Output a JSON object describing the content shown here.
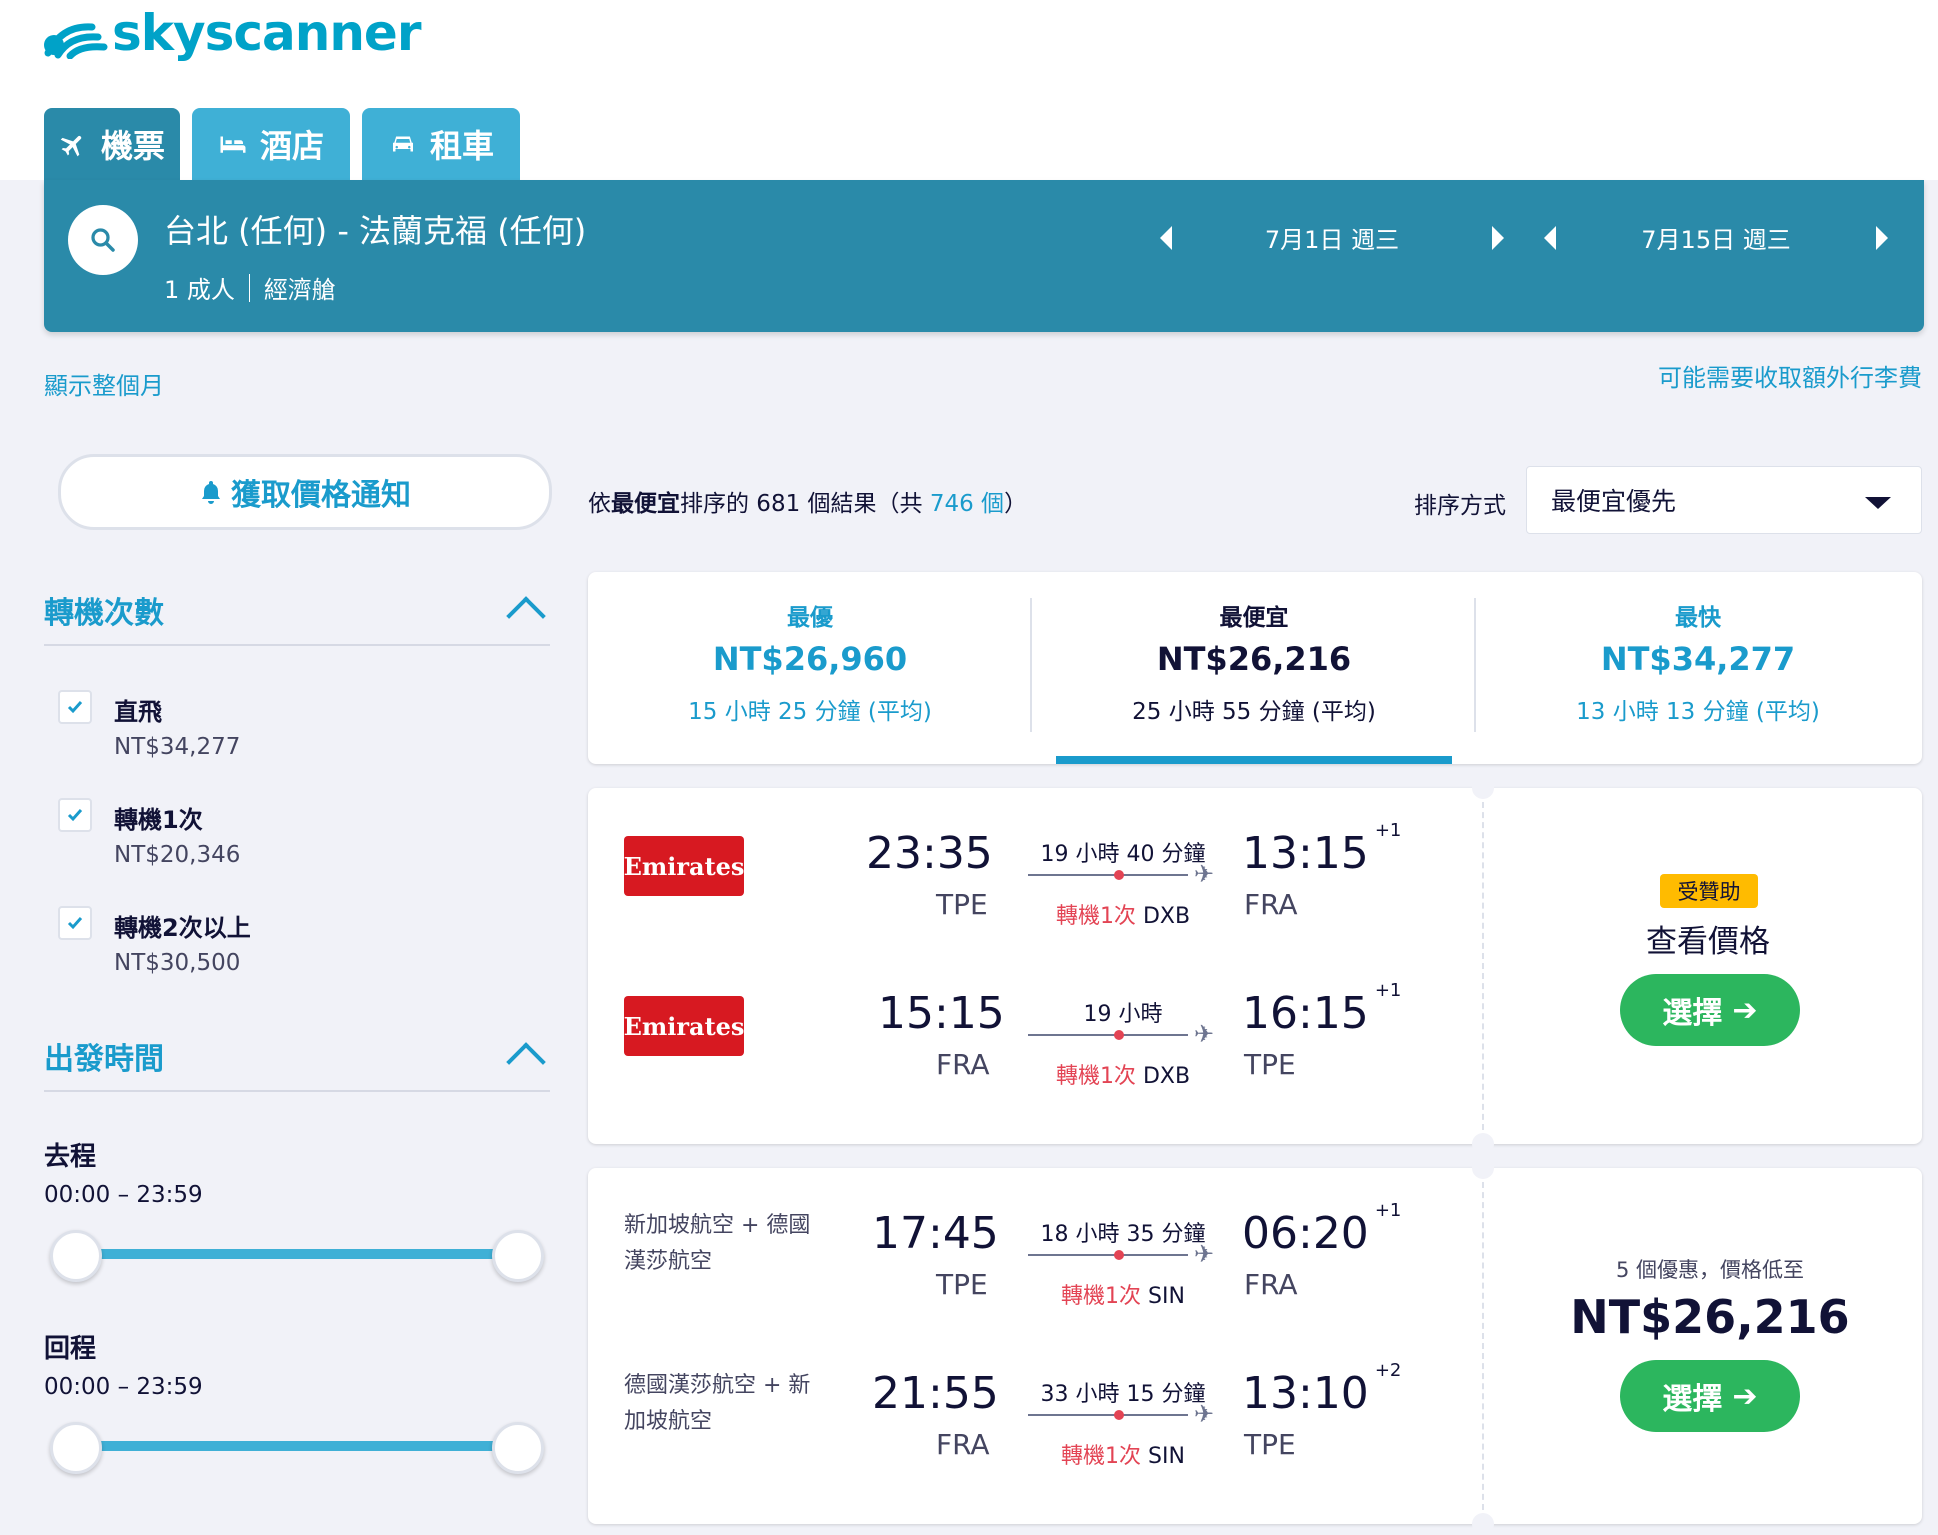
{
  "brand": {
    "name": "skyscanner"
  },
  "tabs": [
    {
      "label": "機票",
      "icon": "plane-icon",
      "active": true
    },
    {
      "label": "酒店",
      "icon": "bed-icon",
      "active": false
    },
    {
      "label": "租車",
      "icon": "car-icon",
      "active": false
    }
  ],
  "search": {
    "route": "台北 (任何) - 法蘭克福 (任何)",
    "adults": "1 成人",
    "cabin": "經濟艙",
    "depart_date": "7月1日 週三",
    "return_date": "7月15日 週三"
  },
  "links": {
    "show_month": "顯示整個月",
    "baggage": "可能需要收取額外行李費"
  },
  "alert": {
    "label": "獲取價格通知"
  },
  "filters": {
    "stops": {
      "title": "轉機次數",
      "options": [
        {
          "label": "直飛",
          "price": "NT$34,277",
          "checked": true
        },
        {
          "label": "轉機1次",
          "price": "NT$20,346",
          "checked": true
        },
        {
          "label": "轉機2次以上",
          "price": "NT$30,500",
          "checked": true
        }
      ]
    },
    "times": {
      "title": "出發時間",
      "outbound_label": "去程",
      "outbound_range": "00:00 – 23:59",
      "return_label": "回程",
      "return_range": "00:00 – 23:59"
    }
  },
  "results": {
    "prefix": "依",
    "sort_word": "最便宜",
    "middle": "排序的 681 個結果（共 ",
    "total": "746 個",
    "suffix": "）"
  },
  "sort": {
    "label": "排序方式",
    "value": "最便宜優先"
  },
  "summary": [
    {
      "title": "最優",
      "price": "NT$26,960",
      "duration": "15 小時 25 分鐘 (平均)"
    },
    {
      "title": "最便宜",
      "price": "NT$26,216",
      "duration": "25 小時 55 分鐘 (平均)",
      "selected": true
    },
    {
      "title": "最快",
      "price": "NT$34,277",
      "duration": "13 小時 13 分鐘 (平均)"
    }
  ],
  "cards": [
    {
      "legs": [
        {
          "airline": "Emirates",
          "dep_time": "23:35",
          "dep_ap": "TPE",
          "duration": "19 小時 40 分鐘",
          "stops": "轉機1次",
          "via": "DXB",
          "arr_time": "13:15",
          "arr_plus": "+1",
          "arr_ap": "FRA"
        },
        {
          "airline": "Emirates",
          "dep_time": "15:15",
          "dep_ap": "FRA",
          "duration": "19 小時",
          "stops": "轉機1次",
          "via": "DXB",
          "arr_time": "16:15",
          "arr_plus": "+1",
          "arr_ap": "TPE"
        }
      ],
      "sponsored": "受贊助",
      "view_price": "查看價格",
      "select": "選擇"
    },
    {
      "legs": [
        {
          "airline": "新加坡航空 + 德國漢莎航空",
          "dep_time": "17:45",
          "dep_ap": "TPE",
          "duration": "18 小時 35 分鐘",
          "stops": "轉機1次",
          "via": "SIN",
          "arr_time": "06:20",
          "arr_plus": "+1",
          "arr_ap": "FRA"
        },
        {
          "airline": "德國漢莎航空 + 新加坡航空",
          "dep_time": "21:55",
          "dep_ap": "FRA",
          "duration": "33 小時 15 分鐘",
          "stops": "轉機1次",
          "via": "SIN",
          "arr_time": "13:10",
          "arr_plus": "+2",
          "arr_ap": "TPE"
        }
      ],
      "deals": "5 個優惠，價格低至",
      "price": "NT$26,216",
      "select": "選擇"
    }
  ]
}
